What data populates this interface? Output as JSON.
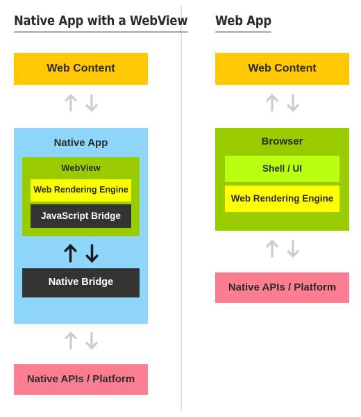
{
  "colors": {
    "yellow": "#FFC800",
    "blue": "#8FD6FB",
    "green": "#9ACD00",
    "bright_green": "#B8FF12",
    "bright_yellow": "#FFFF00",
    "pink": "#FC7E92",
    "dark": "#333333",
    "arrow_light": "#CCCCCC",
    "arrow_dark": "#1C1C1C",
    "divider": "#E3E3E3",
    "text": "#2B2B2B"
  },
  "left": {
    "title": "Native App with a WebView",
    "web_content": "Web Content",
    "native_app": "Native App",
    "webview": "WebView",
    "web_rendering_engine": "Web Rendering Engine",
    "javascript_bridge": "JavaScript Bridge",
    "native_bridge": "Native Bridge",
    "native_apis": "Native APIs / Platform",
    "arrow_up": "↑",
    "arrow_down": "↓"
  },
  "right": {
    "title": "Web App",
    "web_content": "Web Content",
    "browser": "Browser",
    "shell_ui": "Shell / UI",
    "web_rendering_engine": "Web Rendering Engine",
    "native_apis": "Native APIs / Platform",
    "arrow_up": "↑",
    "arrow_down": "↓"
  }
}
